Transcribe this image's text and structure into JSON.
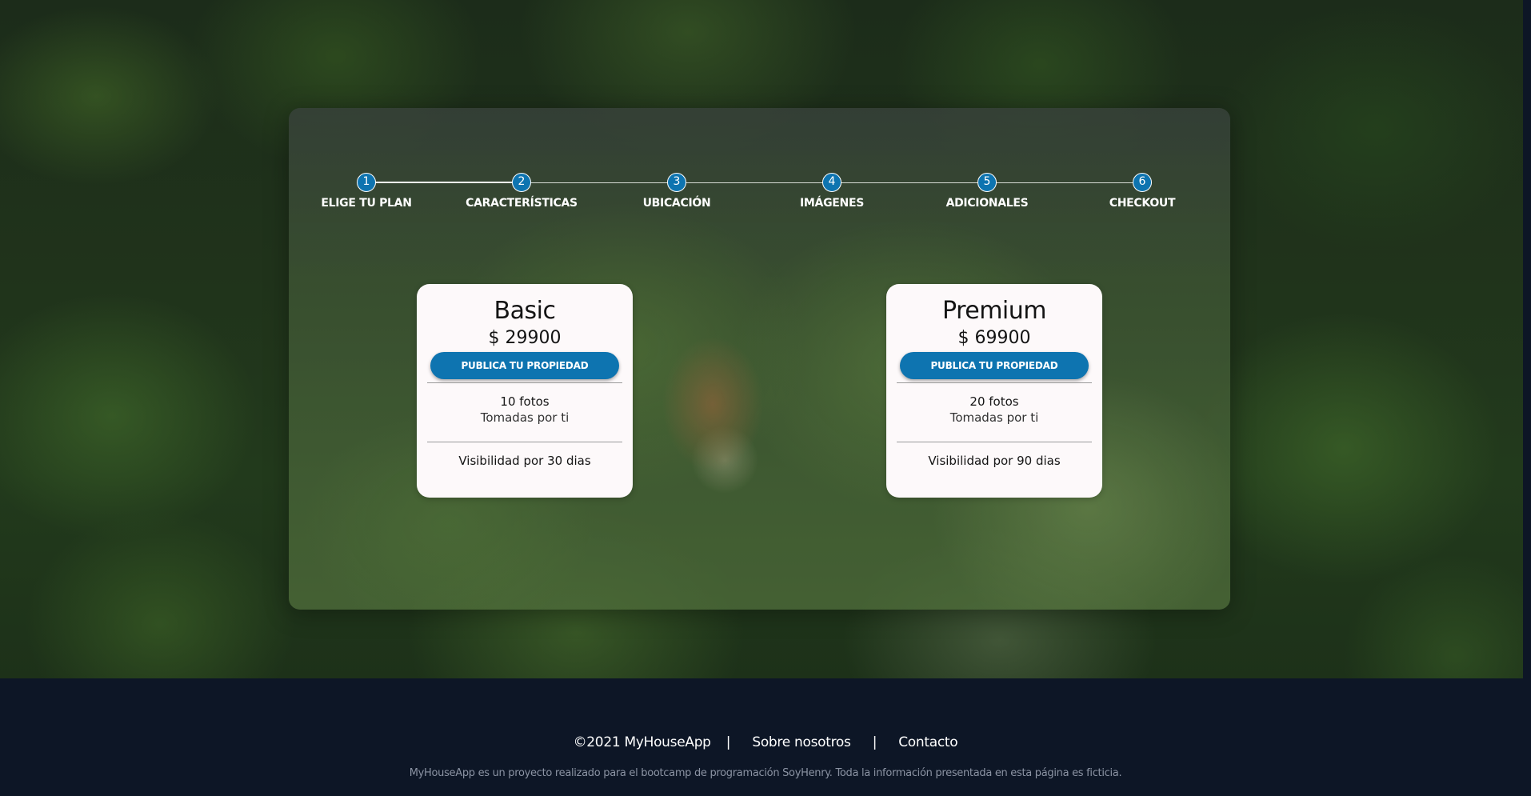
{
  "stepper": {
    "active_step": 1,
    "steps": [
      {
        "number": "1",
        "label": "ELIGE TU PLAN"
      },
      {
        "number": "2",
        "label": "CARACTERÍSTICAS"
      },
      {
        "number": "3",
        "label": "UBICACIÓN"
      },
      {
        "number": "4",
        "label": "IMÁGENES"
      },
      {
        "number": "5",
        "label": "ADICIONALES"
      },
      {
        "number": "6",
        "label": "CHECKOUT"
      }
    ]
  },
  "plans": [
    {
      "title": "Basic",
      "price": "$ 29900",
      "button_label": "PUBLICA TU PROPIEDAD",
      "photos": "10 fotos",
      "photos_sub": "Tomadas por ti",
      "visibility": "Visibilidad por 30 dias"
    },
    {
      "title": "Premium",
      "price": "$ 69900",
      "button_label": "PUBLICA TU PROPIEDAD",
      "photos": "20 fotos",
      "photos_sub": "Tomadas por ti",
      "visibility": "Visibilidad por 90 dias"
    }
  ],
  "footer": {
    "copyright": "©2021 MyHouseApp",
    "separator": "|",
    "about_label": "Sobre nosotros",
    "contact_label": "Contacto",
    "disclaimer": "MyHouseApp es un proyecto realizado para el bootcamp de programación SoyHenry. Toda la información presentada en esta página es ficticia."
  },
  "colors": {
    "accent": "#0e74b0",
    "footer_bg": "#0d1626",
    "card_bg": "#fdf9fa"
  }
}
